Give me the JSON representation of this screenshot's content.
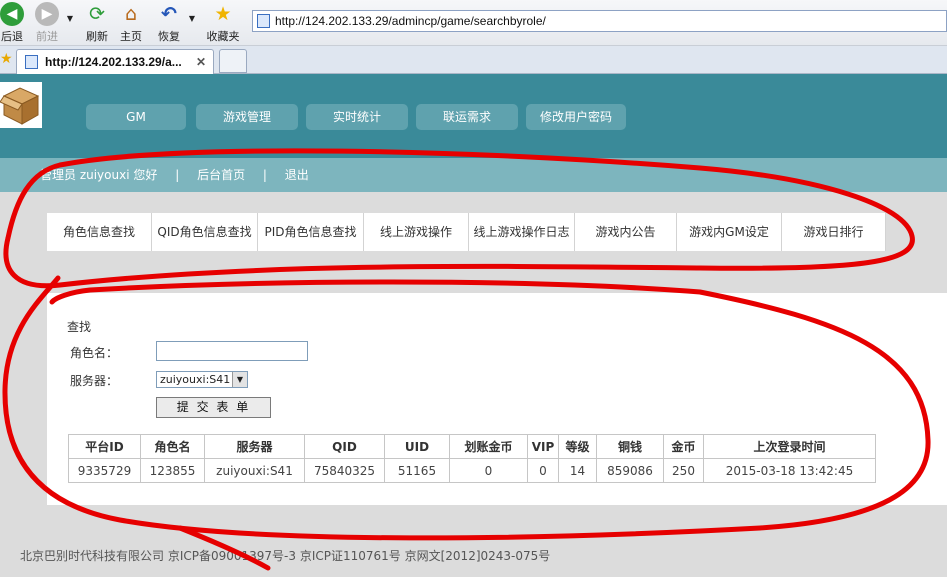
{
  "browser": {
    "buttons": [
      {
        "id": "back",
        "label": "后退",
        "icon": "back-arrow"
      },
      {
        "id": "forward",
        "label": "前进",
        "icon": "forward-arrow"
      },
      {
        "id": "refresh",
        "label": "刷新",
        "icon": "refresh"
      },
      {
        "id": "home",
        "label": "主页",
        "icon": "home"
      },
      {
        "id": "restore",
        "label": "恢复",
        "icon": "undo"
      },
      {
        "id": "favorites",
        "label": "收藏夹",
        "icon": "star"
      }
    ],
    "address": "http://124.202.133.29/admincp/game/searchbyrole/",
    "tab_title": "http://124.202.133.29/a..."
  },
  "header": {
    "nav": [
      "GM",
      "游戏管理",
      "实时统计",
      "联运需求",
      "修改用户密码"
    ]
  },
  "subbar": {
    "greeting": "管理员 zuiyouxi 您好",
    "separator": "|",
    "home_link": "后台首页",
    "logout_link": "退出"
  },
  "subtabs": [
    "角色信息查找",
    "QID角色信息查找",
    "PID角色信息查找",
    "线上游戏操作",
    "线上游戏操作日志",
    "游戏内公告",
    "游戏内GM设定",
    "游戏日排行"
  ],
  "form": {
    "title": "查找",
    "role_label": "角色名：",
    "role_value": "",
    "server_label": "服务器：",
    "server_value": "zuiyouxi:S41",
    "submit_label": "提 交 表 单"
  },
  "table": {
    "headers": [
      "平台ID",
      "角色名",
      "服务器",
      "QID",
      "UID",
      "划账金币",
      "VIP",
      "等级",
      "铜钱",
      "金币",
      "上次登录时间"
    ],
    "rows": [
      [
        "9335729",
        "123855",
        "zuiyouxi:S41",
        "75840325",
        "51165",
        "0",
        "0",
        "14",
        "859086",
        "250",
        "2015-03-18 13:42:45"
      ]
    ]
  },
  "footer": {
    "text": "北京巴别时代科技有限公司 京ICP备09001397号-3 京ICP证110761号 京网文[2012]0243-075号"
  },
  "colors": {
    "header_bg": "#3a8a99",
    "nav_button": "#5fa2ae",
    "subbar_bg": "#7db5be",
    "marker_red": "#e60000"
  }
}
